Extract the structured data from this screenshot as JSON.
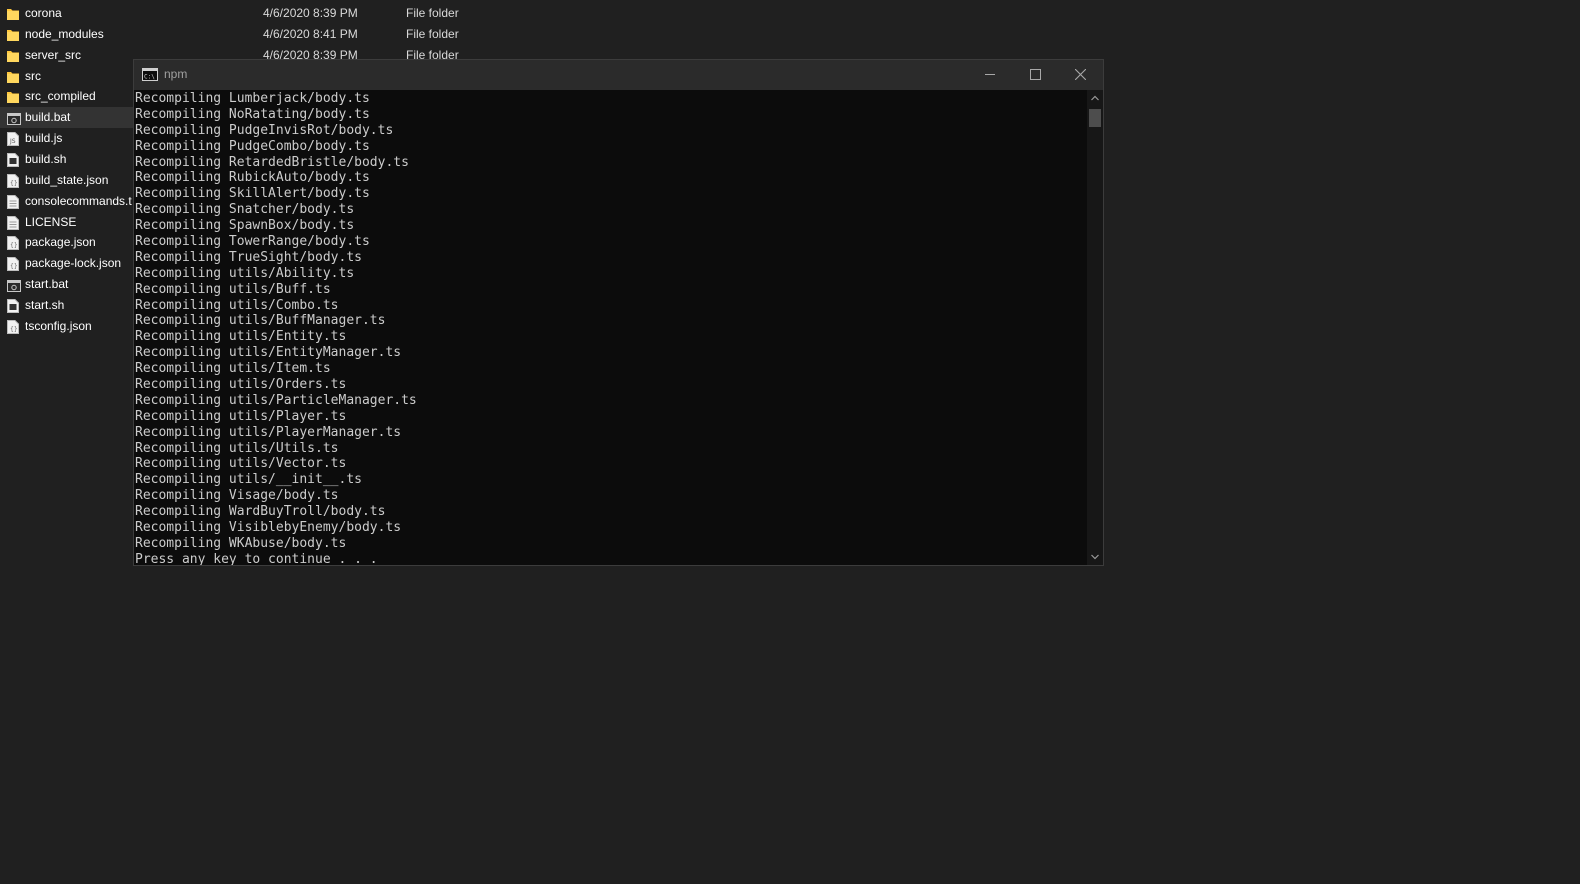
{
  "explorer": {
    "files": [
      {
        "name": "corona",
        "date": "4/6/2020 8:39 PM",
        "type": "File folder",
        "icon": "folder-icon"
      },
      {
        "name": "node_modules",
        "date": "4/6/2020 8:41 PM",
        "type": "File folder",
        "icon": "folder-icon"
      },
      {
        "name": "server_src",
        "date": "4/6/2020 8:39 PM",
        "type": "File folder",
        "icon": "folder-icon"
      },
      {
        "name": "src",
        "date": "",
        "type": "",
        "icon": "folder-icon"
      },
      {
        "name": "src_compiled",
        "date": "",
        "type": "",
        "icon": "folder-icon"
      },
      {
        "name": "build.bat",
        "date": "",
        "type": "",
        "icon": "batch-file-icon",
        "selected": true
      },
      {
        "name": "build.js",
        "date": "",
        "type": "",
        "icon": "js-file-icon"
      },
      {
        "name": "build.sh",
        "date": "",
        "type": "",
        "icon": "shell-file-icon"
      },
      {
        "name": "build_state.json",
        "date": "",
        "type": "",
        "icon": "json-file-icon"
      },
      {
        "name": "consolecommands.t",
        "date": "",
        "type": "",
        "icon": "text-file-icon"
      },
      {
        "name": "LICENSE",
        "date": "",
        "type": "",
        "icon": "text-file-icon"
      },
      {
        "name": "package.json",
        "date": "",
        "type": "",
        "icon": "json-file-icon"
      },
      {
        "name": "package-lock.json",
        "date": "",
        "type": "",
        "icon": "json-file-icon"
      },
      {
        "name": "start.bat",
        "date": "",
        "type": "",
        "icon": "batch-file-icon"
      },
      {
        "name": "start.sh",
        "date": "",
        "type": "",
        "icon": "shell-file-icon"
      },
      {
        "name": "tsconfig.json",
        "date": "",
        "type": "",
        "icon": "json-file-icon"
      }
    ]
  },
  "console": {
    "title": "npm",
    "icon": "cmd-icon",
    "lines": [
      "Recompiling Lumberjack/body.ts",
      "Recompiling NoRatating/body.ts",
      "Recompiling PudgeInvisRot/body.ts",
      "Recompiling PudgeCombo/body.ts",
      "Recompiling RetardedBristle/body.ts",
      "Recompiling RubickAuto/body.ts",
      "Recompiling SkillAlert/body.ts",
      "Recompiling Snatcher/body.ts",
      "Recompiling SpawnBox/body.ts",
      "Recompiling TowerRange/body.ts",
      "Recompiling TrueSight/body.ts",
      "Recompiling utils/Ability.ts",
      "Recompiling utils/Buff.ts",
      "Recompiling utils/Combo.ts",
      "Recompiling utils/BuffManager.ts",
      "Recompiling utils/Entity.ts",
      "Recompiling utils/EntityManager.ts",
      "Recompiling utils/Item.ts",
      "Recompiling utils/Orders.ts",
      "Recompiling utils/ParticleManager.ts",
      "Recompiling utils/Player.ts",
      "Recompiling utils/PlayerManager.ts",
      "Recompiling utils/Utils.ts",
      "Recompiling utils/Vector.ts",
      "Recompiling utils/__init__.ts",
      "Recompiling Visage/body.ts",
      "Recompiling WardBuyTroll/body.ts",
      "Recompiling VisiblebyEnemy/body.ts",
      "Recompiling WKAbuse/body.ts",
      "Press any key to continue . . ."
    ]
  },
  "colors": {
    "desktop_background": "#202020",
    "console_background": "#0c0c0c",
    "console_text": "#cccccc",
    "folder": "#ffc83d"
  }
}
